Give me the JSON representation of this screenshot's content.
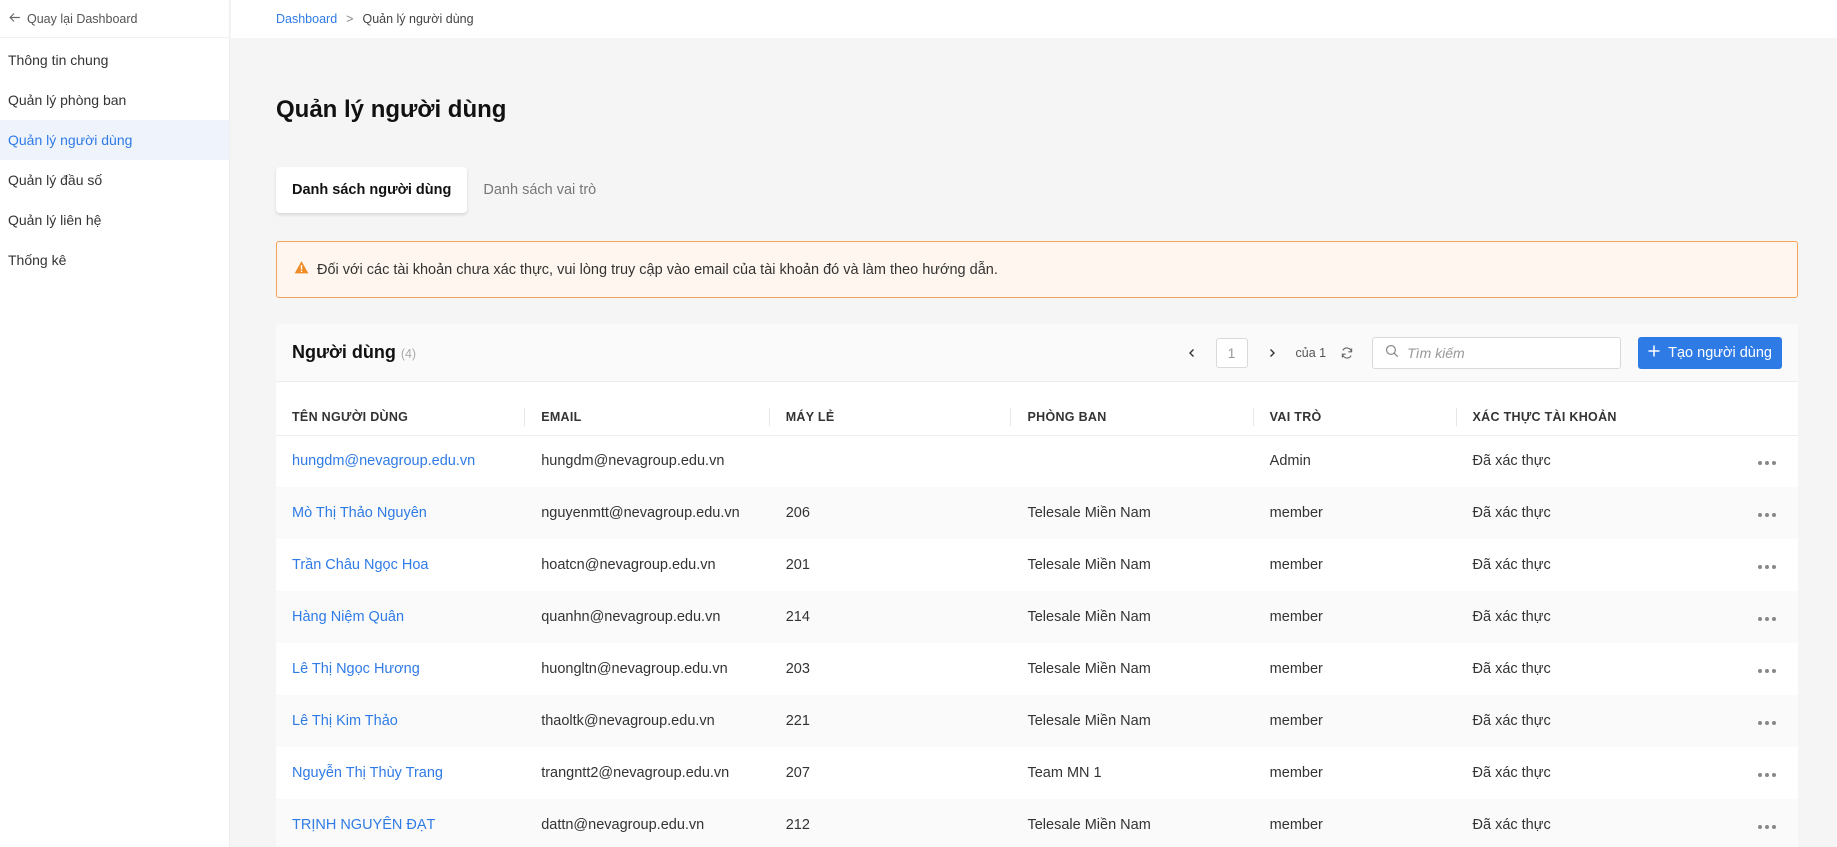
{
  "sidebar": {
    "back_label": "Quay lại Dashboard",
    "items": [
      {
        "label": "Thông tin chung"
      },
      {
        "label": "Quản lý phòng ban"
      },
      {
        "label": "Quản lý người dùng",
        "active": true
      },
      {
        "label": "Quản lý đầu số"
      },
      {
        "label": "Quản lý liên hệ"
      },
      {
        "label": "Thống kê"
      }
    ]
  },
  "breadcrumb": {
    "root": "Dashboard",
    "separator": ">",
    "current": "Quản lý người dùng"
  },
  "page_title": "Quản lý người dùng",
  "tabs": [
    {
      "label": "Danh sách người dùng",
      "active": true
    },
    {
      "label": "Danh sách vai trò"
    }
  ],
  "alert": {
    "text": "Đối với các tài khoản chưa xác thực, vui lòng truy cập vào email của tài khoản đó và làm theo hướng dẫn.",
    "color": "#f3a35a"
  },
  "users_card": {
    "title": "Người dùng",
    "count": "(4)",
    "pager": {
      "current_page": "1",
      "of_label": "của 1"
    },
    "search": {
      "placeholder": "Tìm kiếm",
      "value": ""
    },
    "create_button": "Tạo người dùng",
    "columns": [
      "TÊN NGƯỜI DÙNG",
      "EMAIL",
      "MÁY LẺ",
      "PHÒNG BAN",
      "VAI TRÒ",
      "XÁC THỰC TÀI KHOẢN"
    ],
    "rows": [
      [
        "hungdm@nevagroup.edu.vn",
        "hungdm@nevagroup.edu.vn",
        "",
        "",
        "Admin",
        "Đã xác thực"
      ],
      [
        "Mò Thị Thảo Nguyên",
        "nguyenmtt@nevagroup.edu.vn",
        "206",
        "Telesale Miền Nam",
        "member",
        "Đã xác thực"
      ],
      [
        "Trần Châu Ngọc Hoa",
        "hoatcn@nevagroup.edu.vn",
        "201",
        "Telesale Miền Nam",
        "member",
        "Đã xác thực"
      ],
      [
        "Hàng Niệm Quân",
        "quanhn@nevagroup.edu.vn",
        "214",
        "Telesale Miền Nam",
        "member",
        "Đã xác thực"
      ],
      [
        "Lê Thị Ngọc Hương",
        "huongltn@nevagroup.edu.vn",
        "203",
        "Telesale Miền Nam",
        "member",
        "Đã xác thực"
      ],
      [
        "Lê Thị Kim Thảo",
        "thaoltk@nevagroup.edu.vn",
        "221",
        "Telesale Miền Nam",
        "member",
        "Đã xác thực"
      ],
      [
        "Nguyễn Thị Thùy Trang",
        "trangntt2@nevagroup.edu.vn",
        "207",
        "Team MN 1",
        "member",
        "Đã xác thực"
      ],
      [
        "TRỊNH NGUYÊN ĐẠT",
        "dattn@nevagroup.edu.vn",
        "212",
        "Telesale Miền Nam",
        "member",
        "Đã xác thực"
      ]
    ]
  },
  "colors": {
    "accent": "#2f7be6",
    "active_nav_bg": "#eef3fc",
    "warning": "#f3a35a"
  }
}
